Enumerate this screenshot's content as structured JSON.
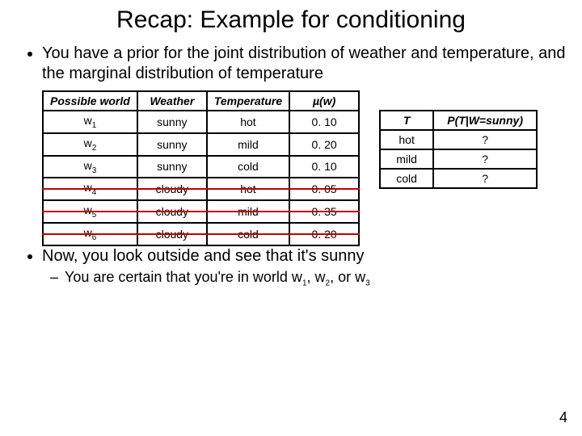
{
  "title": "Recap: Example for conditioning",
  "bullets": {
    "b1": "You have a prior for the joint distribution of weather and temperature, and the marginal distribution of temperature",
    "b2": "Now, you look outside and see that it's sunny",
    "b2sub": "You are certain that you're in world w"
  },
  "sub_tail": ", or w",
  "left": {
    "h1": "Possible world",
    "h2": "Weather",
    "h3": "Temperature",
    "h4": "µ(w)",
    "rows": [
      {
        "w": "w",
        "wi": "1",
        "weather": "sunny",
        "temp": "hot",
        "mu": "0. 10",
        "strike": false
      },
      {
        "w": "w",
        "wi": "2",
        "weather": "sunny",
        "temp": "mild",
        "mu": "0. 20",
        "strike": false
      },
      {
        "w": "w",
        "wi": "3",
        "weather": "sunny",
        "temp": "cold",
        "mu": "0. 10",
        "strike": false
      },
      {
        "w": "w",
        "wi": "4",
        "weather": "cloudy",
        "temp": "hot",
        "mu": "0. 05",
        "strike": true
      },
      {
        "w": "w",
        "wi": "5",
        "weather": "cloudy",
        "temp": "mild",
        "mu": "0. 35",
        "strike": true
      },
      {
        "w": "w",
        "wi": "6",
        "weather": "cloudy",
        "temp": "cold",
        "mu": "0. 20",
        "strike": true
      }
    ]
  },
  "right": {
    "h1": "T",
    "h2": "P(T|W=sunny)",
    "rows": [
      {
        "t": "hot",
        "p": "?"
      },
      {
        "t": "mild",
        "p": "?"
      },
      {
        "t": "cold",
        "p": "?"
      }
    ]
  },
  "page": "4",
  "chart_data": {
    "type": "table",
    "tables": [
      {
        "name": "joint_distribution",
        "columns": [
          "Possible world",
          "Weather",
          "Temperature",
          "µ(w)"
        ],
        "rows": [
          [
            "w1",
            "sunny",
            "hot",
            0.1
          ],
          [
            "w2",
            "sunny",
            "mild",
            0.2
          ],
          [
            "w3",
            "sunny",
            "cold",
            0.1
          ],
          [
            "w4",
            "cloudy",
            "hot",
            0.05
          ],
          [
            "w5",
            "cloudy",
            "mild",
            0.35
          ],
          [
            "w6",
            "cloudy",
            "cold",
            0.2
          ]
        ],
        "struck_rows": [
          "w4",
          "w5",
          "w6"
        ]
      },
      {
        "name": "conditional",
        "columns": [
          "T",
          "P(T|W=sunny)"
        ],
        "rows": [
          [
            "hot",
            "?"
          ],
          [
            "mild",
            "?"
          ],
          [
            "cold",
            "?"
          ]
        ]
      }
    ]
  }
}
